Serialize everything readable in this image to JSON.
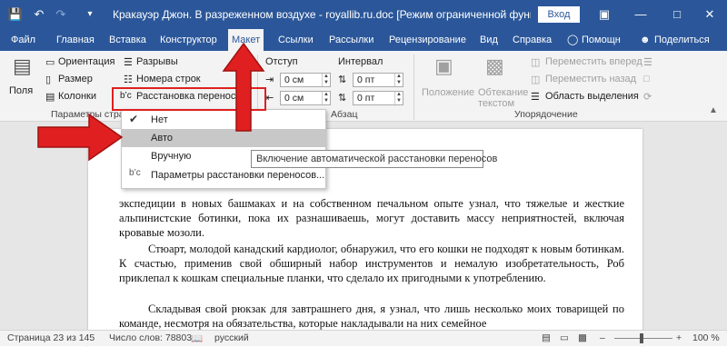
{
  "titlebar": {
    "title": "Кракауэр Джон. В разреженном воздухе - royallib.ru.doc [Режим ограниченной функциональности]",
    "signin": "Вход",
    "icons": [
      "save-icon",
      "undo-icon",
      "redo-icon",
      "customize-icon",
      "ribbon-options-icon",
      "minimize-icon",
      "maximize-icon",
      "close-icon"
    ]
  },
  "tabs": [
    "Файл",
    "Главная",
    "Вставка",
    "Конструктор",
    "Макет",
    "Ссылки",
    "Рассылки",
    "Рецензирование",
    "Вид",
    "Справка",
    "Помощн",
    "Поделиться"
  ],
  "active_tab": "Макет",
  "ribbon": {
    "fields_label": "Поля",
    "orientation": "Ориентация",
    "size": "Размер",
    "columns": "Колонки",
    "breaks": "Разрывы",
    "line_numbers": "Номера строк",
    "hyphenation": "Расстановка переносов",
    "group_page_setup": "Параметры страницы",
    "indent_label": "Отступ",
    "spacing_label": "Интервал",
    "indent_left": "0 см",
    "indent_right": "0 см",
    "spacing_before": "0 пт",
    "spacing_after": "0 пт",
    "group_paragraph": "Абзац",
    "position": "Положение",
    "wrap_text": "Обтекание текстом",
    "bring_forward": "Переместить вперед",
    "send_backward": "Переместить назад",
    "selection_pane": "Область выделения",
    "group_arrange": "Упорядочение"
  },
  "menu": {
    "items": [
      "Нет",
      "Авто",
      "Вручную",
      "Параметры расстановки переносов..."
    ],
    "checked": "Нет",
    "highlighted": "Авто"
  },
  "tooltip": "Включение автоматической расстановки переносов",
  "document": {
    "paragraphs": [
      "экспедиции в новых башмаках и на собственном печальном опыте узнал, что тяжелые и жесткие альпинистские ботинки, пока их разнашиваешь, могут доставить массу неприятностей, включая кровавые мозоли.",
      "Стюарт, молодой канадский кардиолог, обнаружил, что его кошки не подходят к новым ботинкам. К счастью, применив свой обширный набор инструментов и немалую изобретательность, Роб приклепал к кошкам специальные планки, что сделало их пригодными к употреблению.",
      "Складывая свой рюкзак для завтрашнего дня, я узнал, что лишь несколько моих товарищей по команде, несмотря на обязательства, которые накладывали на них семейное"
    ]
  },
  "status": {
    "page": "Страница 23 из 145",
    "words": "Число слов: 78803",
    "language": "русский",
    "zoom": "100 %"
  },
  "colors": {
    "accent": "#2b579a",
    "annotation": "#e02020"
  }
}
